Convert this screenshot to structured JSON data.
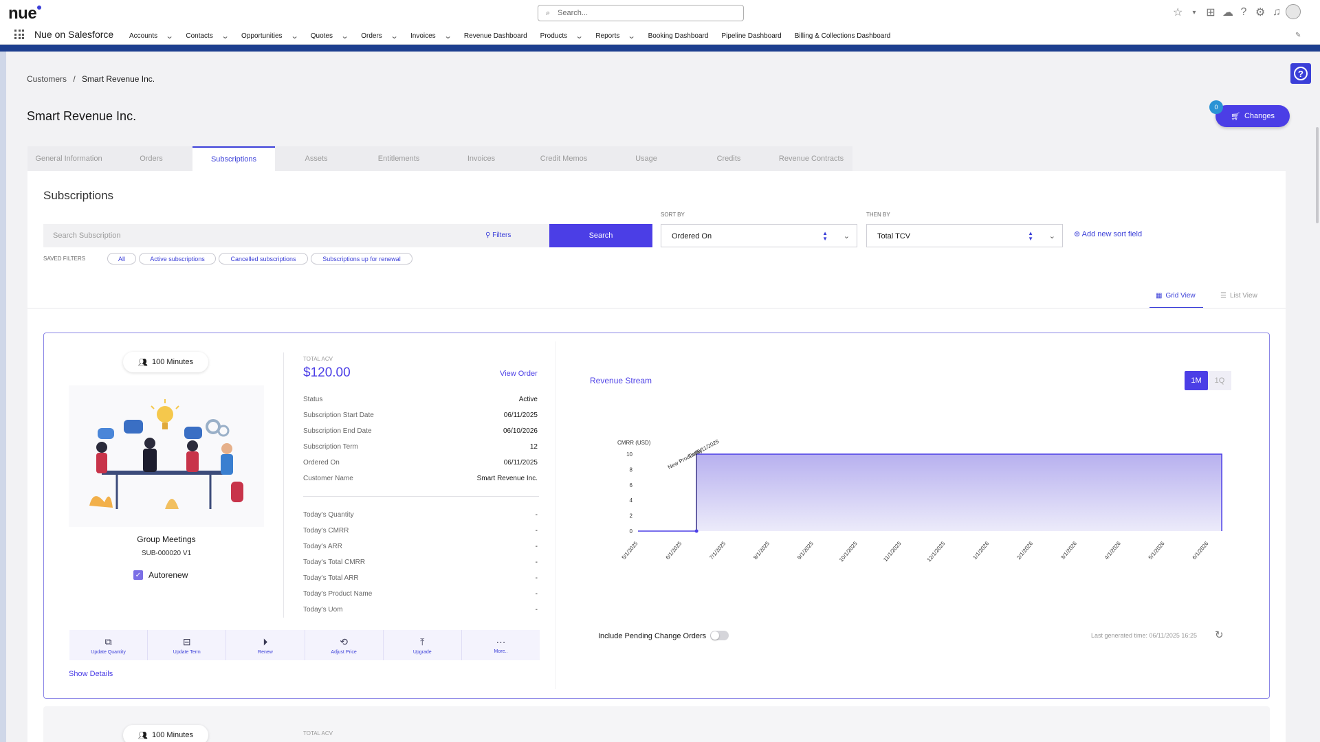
{
  "app": {
    "name": "Nue on Salesforce",
    "global_search_placeholder": "Search...",
    "nav": [
      {
        "label": "Accounts",
        "dropdown": true
      },
      {
        "label": "Contacts",
        "dropdown": true
      },
      {
        "label": "Opportunities",
        "dropdown": true
      },
      {
        "label": "Quotes",
        "dropdown": true
      },
      {
        "label": "Orders",
        "dropdown": true
      },
      {
        "label": "Invoices",
        "dropdown": true
      },
      {
        "label": "Revenue Dashboard",
        "dropdown": false
      },
      {
        "label": "Products",
        "dropdown": true
      },
      {
        "label": "Reports",
        "dropdown": true
      },
      {
        "label": "Booking Dashboard",
        "dropdown": false
      },
      {
        "label": "Pipeline Dashboard",
        "dropdown": false
      },
      {
        "label": "Billing & Collections Dashboard",
        "dropdown": false
      }
    ]
  },
  "breadcrumb": {
    "parent": "Customers",
    "separator": "/",
    "current": "Smart Revenue Inc."
  },
  "page": {
    "title": "Smart Revenue Inc.",
    "changes_label": "Changes",
    "changes_count": "0"
  },
  "tabs": [
    "General Information",
    "Orders",
    "Subscriptions",
    "Assets",
    "Entitlements",
    "Invoices",
    "Credit Memos",
    "Usage",
    "Credits",
    "Revenue Contracts"
  ],
  "active_tab": "Subscriptions",
  "subscriptions": {
    "title": "Subscriptions",
    "search_placeholder": "Search Subscription",
    "filters_label": "Filters",
    "search_button": "Search",
    "sort_by_label": "SORT BY",
    "sort_by_value": "Ordered On",
    "then_by_label": "THEN BY",
    "then_by_value": "Total TCV",
    "add_sort_label": "Add new sort field",
    "saved_filters_label": "SAVED FILTERS",
    "saved_filters": [
      "All",
      "Active subscriptions",
      "Cancelled subscriptions",
      "Subscriptions up for renewal"
    ],
    "grid_view_label": "Grid View",
    "list_view_label": "List View"
  },
  "card": {
    "pill_label": "100 Minutes",
    "product_name": "Group Meetings",
    "subscription_id": "SUB-000020 V1",
    "autorenew_label": "Autorenew",
    "autorenew_checked": true,
    "total_acv_label": "TOTAL ACV",
    "total_acv_value": "$120.00",
    "view_order_label": "View Order",
    "details": [
      {
        "label": "Status",
        "value": "Active"
      },
      {
        "label": "Subscription Start Date",
        "value": "06/11/2025"
      },
      {
        "label": "Subscription End Date",
        "value": "06/10/2026"
      },
      {
        "label": "Subscription Term",
        "value": "12"
      },
      {
        "label": "Ordered On",
        "value": "06/11/2025"
      },
      {
        "label": "Customer Name",
        "value": "Smart Revenue Inc."
      }
    ],
    "today": [
      {
        "label": "Today's Quantity",
        "value": "-"
      },
      {
        "label": "Today's CMRR",
        "value": "-"
      },
      {
        "label": "Today's ARR",
        "value": "-"
      },
      {
        "label": "Today's Total CMRR",
        "value": "-"
      },
      {
        "label": "Today's Total ARR",
        "value": "-"
      },
      {
        "label": "Today's Product Name",
        "value": "-"
      },
      {
        "label": "Today's Uom",
        "value": "-"
      }
    ],
    "actions": [
      {
        "label": "Update Quantity",
        "icon": "copy-icon",
        "glyph": "⧉"
      },
      {
        "label": "Update Term",
        "icon": "minus-square-icon",
        "glyph": "⊟"
      },
      {
        "label": "Renew",
        "icon": "play-circle-icon",
        "glyph": "⏵"
      },
      {
        "label": "Adjust Price",
        "icon": "price-tag-icon",
        "glyph": "⟲"
      },
      {
        "label": "Upgrade",
        "icon": "upgrade-arrow-icon",
        "glyph": "⤒"
      },
      {
        "label": "More..",
        "icon": "more-dots-icon",
        "glyph": "···"
      }
    ],
    "show_details_label": "Show Details",
    "revenue_stream_title": "Revenue Stream",
    "period_buttons": [
      "1M",
      "1Q"
    ],
    "active_period": "1M",
    "pending_label": "Include Pending Change Orders",
    "pending_enabled": false,
    "last_generated": "Last generated time: 06/11/2025 16:25"
  },
  "second_card": {
    "pill_label": "100 Minutes",
    "total_acv_label": "TOTAL ACV"
  },
  "chart_data": {
    "type": "area",
    "ylabel": "CMRR (USD)",
    "ylim": [
      0,
      10
    ],
    "yticks": [
      0,
      2,
      4,
      6,
      8,
      10
    ],
    "x": [
      "5/1/2025",
      "6/1/2025",
      "7/1/2025",
      "8/1/2025",
      "9/1/2025",
      "10/1/2025",
      "11/1/2025",
      "12/1/2025",
      "1/1/2026",
      "2/1/2026",
      "3/1/2026",
      "4/1/2026",
      "5/1/2026",
      "6/1/2026"
    ],
    "series": [
      {
        "values": [
          0,
          0,
          10,
          10,
          10,
          10,
          10,
          10,
          10,
          10,
          10,
          10,
          10,
          10
        ],
        "step_start": "6/11/2025",
        "end": "6/10/2026"
      }
    ],
    "annotation": {
      "x": "6/11/2025",
      "labels": [
        "Today",
        "New Product 6/11/2025"
      ]
    },
    "color": "#4b3ee6"
  },
  "colors": {
    "accent": "#4b3ee6",
    "nav_stripe": "#1d3f8f"
  }
}
